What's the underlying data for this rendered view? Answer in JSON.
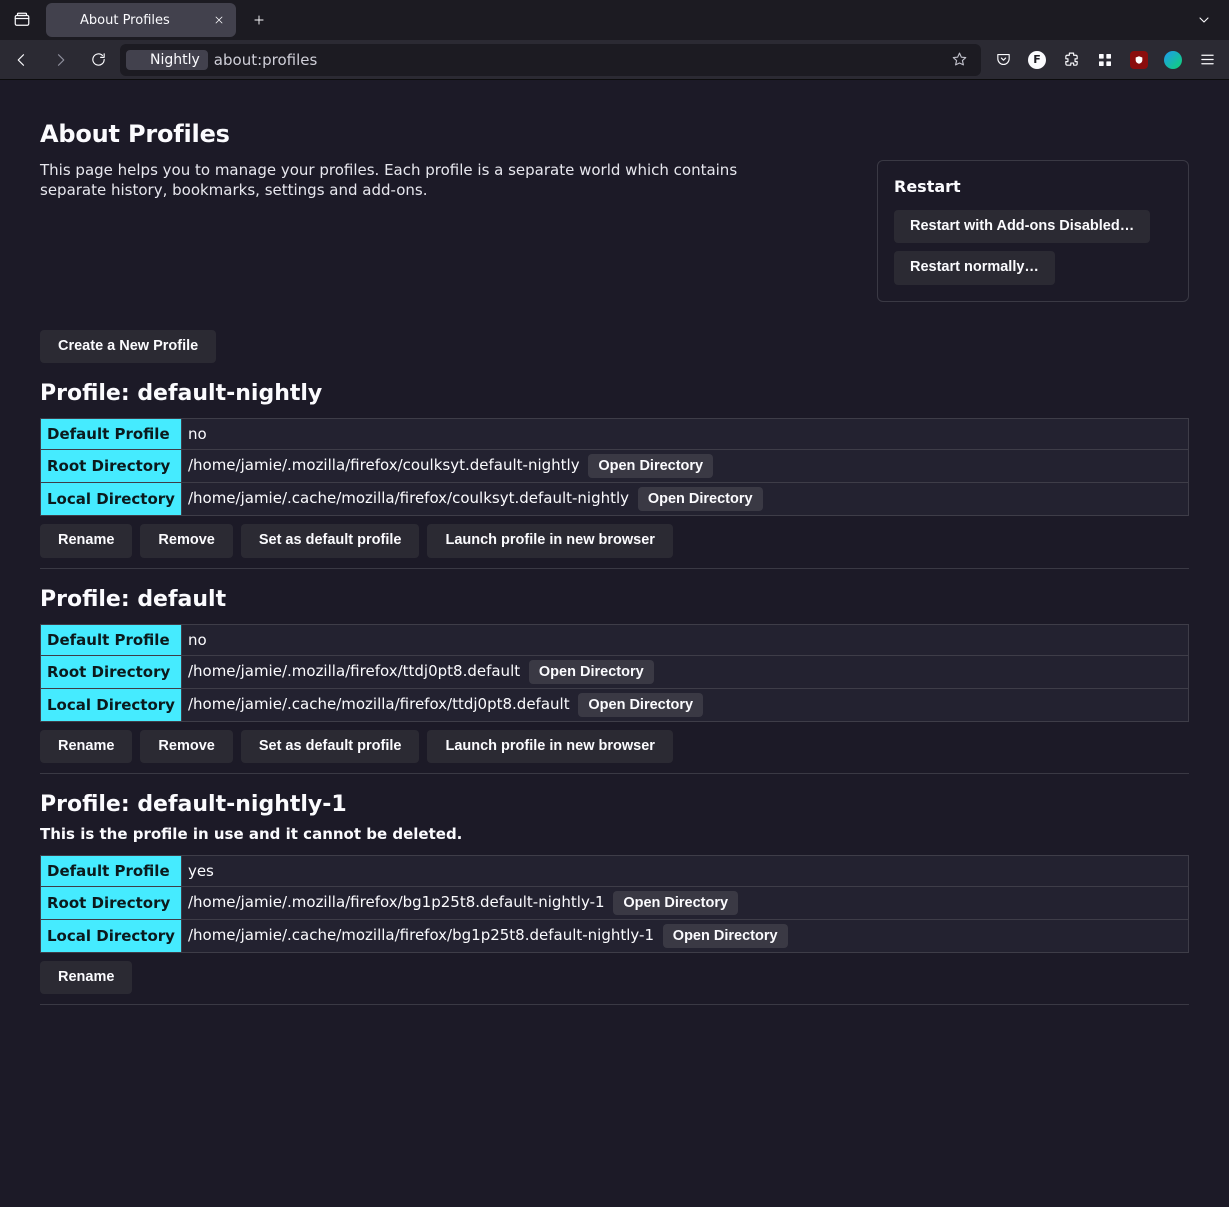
{
  "browser": {
    "tab_title": "About Profiles",
    "identity_label": "Nightly",
    "url": "about:profiles",
    "ext_letter": "F"
  },
  "page": {
    "title": "About Profiles",
    "intro": "This page helps you to manage your profiles. Each profile is a separate world which contains separate history, bookmarks, settings and add-ons.",
    "restart": {
      "heading": "Restart",
      "disabled_btn": "Restart with Add-ons Disabled…",
      "normal_btn": "Restart normally…"
    },
    "create_btn": "Create a New Profile",
    "labels": {
      "default_profile": "Default Profile",
      "root_dir": "Root Directory",
      "local_dir": "Local Directory",
      "open_dir": "Open Directory",
      "rename": "Rename",
      "remove": "Remove",
      "set_default": "Set as default profile",
      "launch": "Launch profile in new browser"
    },
    "profiles": [
      {
        "heading": "Profile: default-nightly",
        "in_use": "",
        "default": "no",
        "root": "/home/jamie/.mozilla/firefox/coulksyt.default-nightly",
        "local": "/home/jamie/.cache/mozilla/firefox/coulksyt.default-nightly",
        "can_remove": true
      },
      {
        "heading": "Profile: default",
        "in_use": "",
        "default": "no",
        "root": "/home/jamie/.mozilla/firefox/ttdj0pt8.default",
        "local": "/home/jamie/.cache/mozilla/firefox/ttdj0pt8.default",
        "can_remove": true
      },
      {
        "heading": "Profile: default-nightly-1",
        "in_use": "This is the profile in use and it cannot be deleted.",
        "default": "yes",
        "root": "/home/jamie/.mozilla/firefox/bg1p25t8.default-nightly-1",
        "local": "/home/jamie/.cache/mozilla/firefox/bg1p25t8.default-nightly-1",
        "can_remove": false
      }
    ]
  }
}
